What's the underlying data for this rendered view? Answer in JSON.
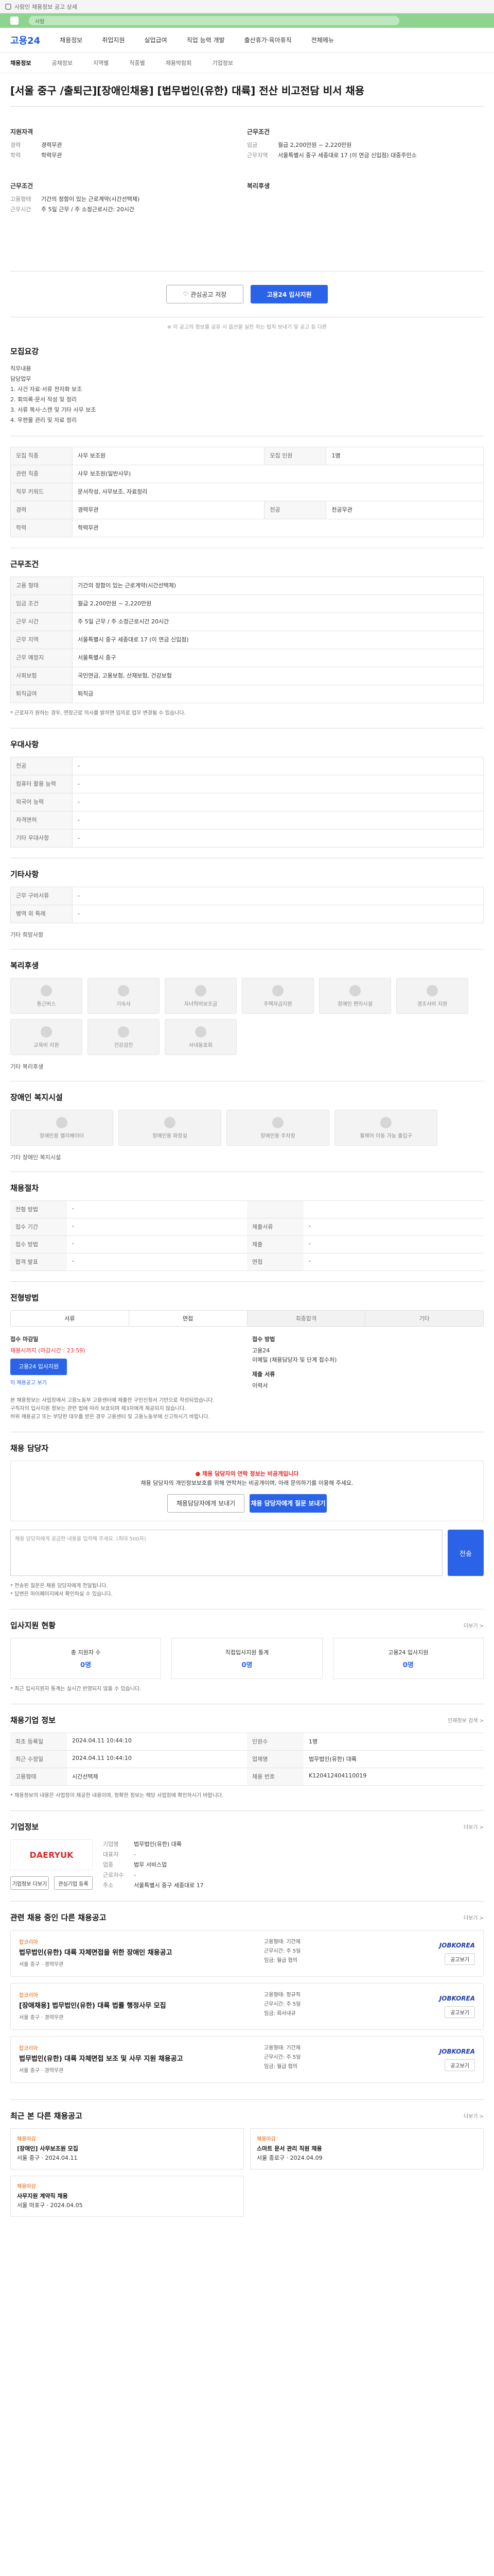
{
  "browser": {
    "address": "사람인 채용정보 공고 상세",
    "tab": "사람"
  },
  "gnb": {
    "logo": "고용24",
    "items": [
      "채용정보",
      "취업지원",
      "실업급여",
      "직업 능력 개발",
      "출산휴가·육아휴직",
      "전체메뉴"
    ]
  },
  "crumbs": [
    "채용정보",
    "공채정보",
    "지역별",
    "직종별",
    "채용박람회",
    "기업정보"
  ],
  "job": {
    "title": "[서울 중구 /출퇴근][장애인채용] [법무법인(유한) 대륙] 전산 비고전담 비서 채용",
    "summary_left_heading": "지원자격",
    "summary_left": [
      {
        "k": "경력",
        "v": "경력무관"
      },
      {
        "k": "학력",
        "v": "학력무관"
      }
    ],
    "summary_left_heading2": "근무조건",
    "summary_left2": [
      {
        "k": "고용형태",
        "v": "기간의 정함이 있는 근로계약(시간선택제)"
      },
      {
        "k": "근무시간",
        "v": "주 5일 근무 / 주 소정근로시간: 20시간"
      }
    ],
    "summary_right_heading": "근무조건",
    "summary_right": [
      {
        "k": "임금",
        "v": "월급 2,200만원 ~ 2,220만원"
      },
      {
        "k": "근무지역",
        "v": "서울특별시 중구 세종대로 17 (이 연금 신입점) 대중주민소"
      }
    ],
    "summary_right_heading2": "복리후생",
    "summary_right2": []
  },
  "actions": {
    "save": "관심공고 저장",
    "apply": "고용24 입사지원",
    "note": "※ 이 공고의 정보를 공유 시 옵션을 실천 하는 법칙 보내기 및 공고 등 다른"
  },
  "section_apply_req": {
    "heading": "모집요강",
    "body": "직무내용\n담당업무\n1. 사건 자료·서류 전자화 보조\n2. 회의록·문서 작성 및 정리\n3. 서류 복사·스캔 및 기타 사무 보조\n4. 우편물 관리 및 자료 정리"
  },
  "section_detail": {
    "rows": [
      {
        "k": "모집 직종",
        "v": "사무 보조원"
      },
      {
        "k": "관련 직종",
        "v": "사무 보조원(일반사무)"
      },
      {
        "k": "직무 키워드",
        "v": "문서작성, 사무보조, 자료정리"
      },
      {
        "k": "경력",
        "v": "경력무관"
      },
      {
        "k": "학력",
        "v": "학력무관"
      }
    ],
    "extra_k": "모집 인원",
    "extra_v": "1명",
    "extra_k2": "전공",
    "extra_v2": "전공무관"
  },
  "section_conditions": {
    "heading": "근무조건",
    "rows": [
      {
        "k": "고용 형태",
        "v": "기간의 정함이 있는 근로계약(시간선택제)"
      },
      {
        "k": "임금 조건",
        "v": "월급 2,200만원 ~ 2,220만원"
      },
      {
        "k": "근무 시간",
        "v": "주 5일 근무 / 주 소정근로시간 20시간"
      },
      {
        "k": "근무 지역",
        "v": "서울특별시 중구 세종대로 17 (이 연금 신입점)"
      },
      {
        "k": "근무 예정지",
        "v": "서울특별시 중구"
      },
      {
        "k": "사회보험",
        "v": "국민연금, 고용보험, 산재보험, 건강보험"
      },
      {
        "k": "퇴직급여",
        "v": "퇴직금"
      }
    ],
    "note": "* 근로자가 원하는 경우, 연장근로 의사를 밝히면 임의로 업무 변경될 수 있습니다."
  },
  "section_priority": {
    "heading": "우대사항",
    "rows": [
      {
        "k": "전공",
        "v": "-"
      },
      {
        "k": "컴퓨터 활용 능력",
        "v": "-"
      },
      {
        "k": "외국어 능력",
        "v": "-"
      },
      {
        "k": "자격면허",
        "v": "-"
      },
      {
        "k": "기타 우대사항",
        "v": "-"
      }
    ]
  },
  "section_other": {
    "heading": "기타사항",
    "rows": [
      {
        "k": "근무 구비서류",
        "v": "-"
      },
      {
        "k": "병역 외 특례",
        "v": "-"
      }
    ],
    "tag": "기타 희망사항"
  },
  "section_welfare": {
    "heading": "복리후생",
    "items": [
      "통근버스",
      "기숙사",
      "자녀학비보조금",
      "주택자금지원",
      "장애인 편의시설",
      "경조사비 지원",
      "교육비 지원",
      "건강검진",
      "사내동호회"
    ],
    "desc": "기타 복리후생"
  },
  "section_disability": {
    "heading": "장애인 복지시설",
    "items": [
      "장애인용 엘리베이터",
      "장애인용 화장실",
      "장애인용 주차장",
      "휠체어 이동 가능 출입구"
    ],
    "desc": "기타 장애인 복지시설"
  },
  "section_process": {
    "heading": "채용절차",
    "rows": [
      {
        "k": "전형 방법",
        "v": "-",
        "k2": "",
        "v2": ""
      },
      {
        "k": "접수 기간",
        "v": "-",
        "k2": "제출서류",
        "v2": "-"
      },
      {
        "k": "접수 방법",
        "v": "-",
        "k2": "제출",
        "v2": "-"
      },
      {
        "k": "합격 발표",
        "v": "-",
        "k2": "면접",
        "v2": "-"
      }
    ]
  },
  "section_steps": {
    "heading": "전형방법",
    "steps": [
      "서류",
      "면접",
      "최종합격",
      "기타"
    ]
  },
  "section_receive": {
    "h1": "접수 마감일",
    "h1_value": "채용시까지 (마감시간 : 23:59)",
    "h1_btn": "고용24 입사지원",
    "h1_link": "이 채용공고 보기",
    "h2": "접수 방법",
    "h2_value": "고용24\n이메일 (채용담당자 및 단계 접수처)",
    "h3": "제출 서류",
    "h3_value": "이력서",
    "fine": "본 채용정보는 사업장에서 고용노동부 고용센터에 제출한 구인신청서 기반으로 작성되었습니다.\n구직자의 입사지원 정보는 관련 법에 따라 보호되며 제3자에게 제공되지 않습니다.\n허위 채용공고 또는 부당한 대우를 받은 경우 고용센터 및 고용노동부에 신고하시기 바랍니다."
  },
  "section_contact": {
    "heading": "채용 담당자",
    "warn": "채용 담당자의 연락 정보는 비공개입니다",
    "body": "채용 담당자의 개인정보보호를 위해 연락처는 비공개이며, 아래 문의하기를 이용해 주세요.",
    "btn1": "채용담당자에게 보내기",
    "btn2": "채용 담당자에게 질문 보내기",
    "q_placeholder": "채용 담당자에게 궁금한 내용을 입력해 주세요. (최대 500자)",
    "send": "전송",
    "fine": "* 전송된 질문은 채용 담당자에게 전달됩니다.\n* 답변은 마이페이지에서 확인하실 수 있습니다."
  },
  "section_status": {
    "heading": "입사지원 현황",
    "more": "더보기 >",
    "stats": [
      {
        "label": "총 지원자 수",
        "value": "0명"
      },
      {
        "label": "직접입사지원 통계",
        "value": "0명"
      },
      {
        "label": "고용24 입사지원",
        "value": "0명"
      }
    ],
    "note": "* 최근 입사지원자 통계는 실시간 반영되지 않을 수 있습니다."
  },
  "section_info": {
    "heading": "채용기업 정보",
    "more": "인재정보 검색 >",
    "rows": [
      {
        "k": "최초 등록일",
        "v": "2024.04.11 10:44:10",
        "k2": "인원수",
        "v2": "1명"
      },
      {
        "k": "최근 수정일",
        "v": "2024.04.11 10:44:10",
        "k2": "업체명",
        "v2": "법무법인(유한) 대륙"
      },
      {
        "k": "고용형태",
        "v": "시간선택제",
        "k2": "채용 번호",
        "v2": "K120412404110019"
      }
    ],
    "fine": "* 채용정보의 내용은 사업장이 제공한 내용이며, 정확한 정보는 해당 사업장에 확인하시기 바랍니다."
  },
  "section_company": {
    "heading": "기업정보",
    "more": "더보기 >",
    "logo": "DAERYUK",
    "rows": [
      {
        "k": "기업명",
        "v": "법무법인(유한) 대륙"
      },
      {
        "k": "대표자",
        "v": "-"
      },
      {
        "k": "업종",
        "v": "법무 서비스업"
      },
      {
        "k": "근로자수",
        "v": "-"
      },
      {
        "k": "주소",
        "v": "서울특별시 중구 세종대로 17"
      }
    ],
    "btn1": "기업정보 더보기",
    "btn2": "관심기업 등록"
  },
  "section_related": {
    "heading": "관련 채용 중인 다른 채용공고",
    "more": "더보기 >",
    "cards": [
      {
        "tag": "잡코리아",
        "title": "법무법인(유한) 대륙 자체면접을 위한 장애인 채용공고",
        "meta": "서울 중구 · 경력무관",
        "detail": "고용형태: 기간제\n근무시간: 주 5일\n임금: 월급 협의",
        "brand": "JOBKOREA",
        "bbtn": "공고보기"
      },
      {
        "tag": "잡코리아",
        "title": "[장애채용] 법무법인(유한) 대륙 법률 행정사무 모집",
        "meta": "서울 중구 · 경력무관",
        "detail": "고용형태: 정규직\n근무시간: 주 5일\n임금: 회사내규",
        "brand": "JOBKOREA",
        "bbtn": "공고보기"
      },
      {
        "tag": "잡코리아",
        "title": "법무법인(유한) 대륙 자체면접 보조 및 사무 지원 채용공고",
        "meta": "서울 중구 · 경력무관",
        "detail": "고용형태: 기간제\n근무시간: 주 5일\n임금: 월급 협의",
        "brand": "JOBKOREA",
        "bbtn": "공고보기"
      }
    ]
  },
  "section_recent": {
    "heading": "최근 본 다른 채용공고",
    "more": "더보기 >",
    "cards": [
      {
        "tag": "채용마감",
        "title": "[장애인] 사무보조원 모집",
        "meta": "서울 중구 · 2024.04.11"
      },
      {
        "tag": "채용마감",
        "title": "스마트 문서 관리 직원 채용",
        "meta": "서울 종로구 · 2024.04.09"
      },
      {
        "tag": "채용마감",
        "title": "사무지원 계약직 채용",
        "meta": "서울 마포구 · 2024.04.05"
      }
    ]
  }
}
